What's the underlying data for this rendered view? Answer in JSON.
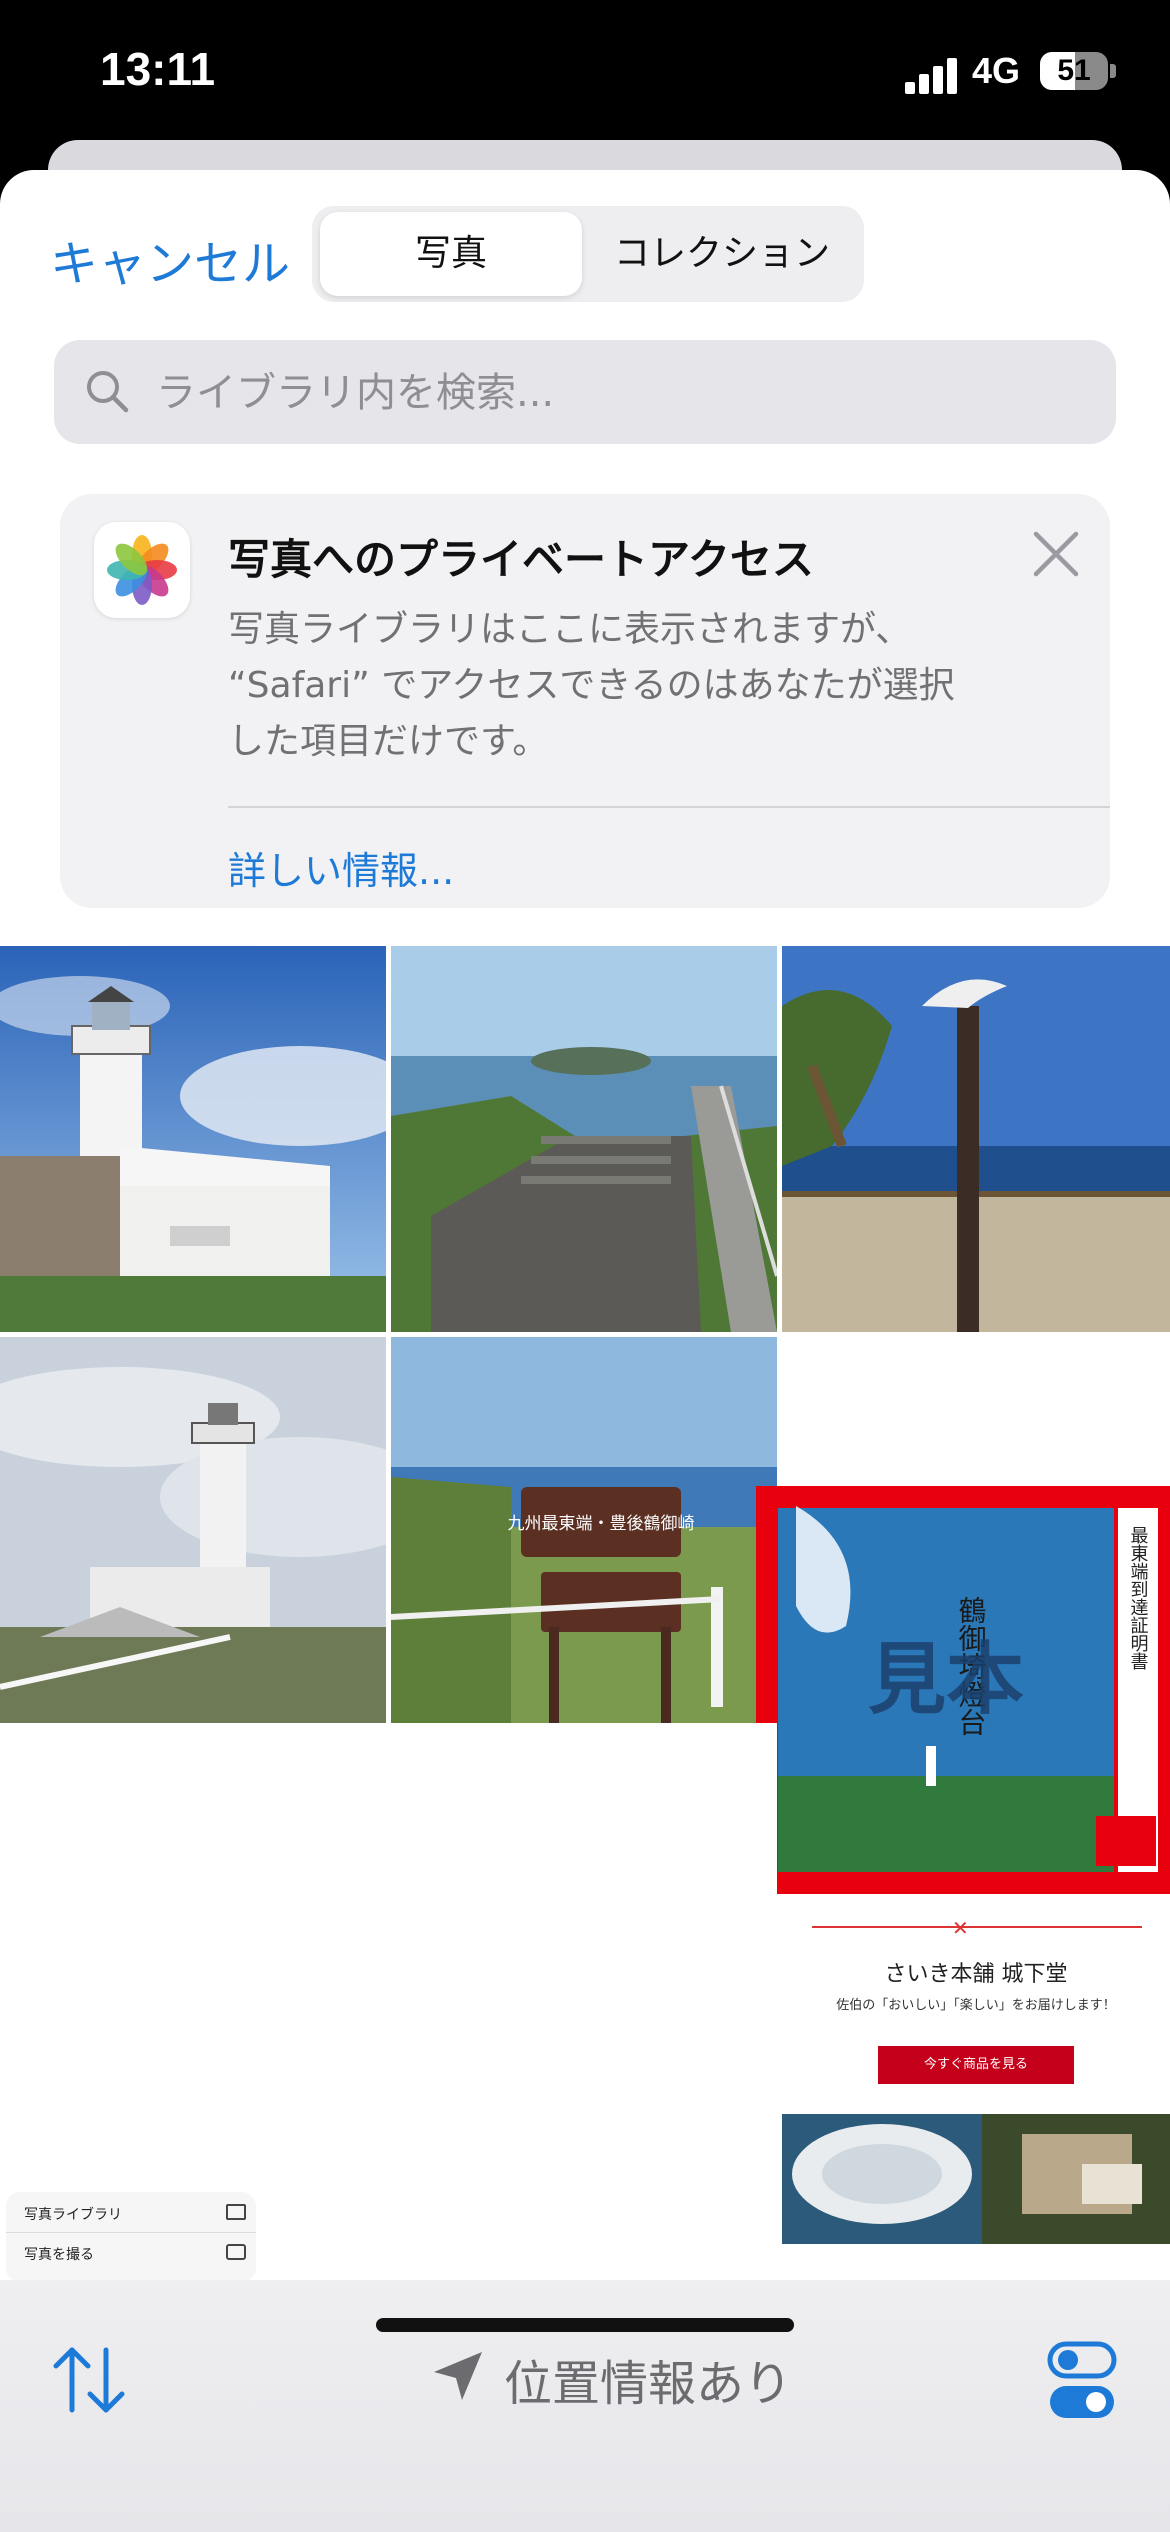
{
  "status_bar": {
    "time": "13:11",
    "network": "4G",
    "battery": "51",
    "battery_level": 0.51
  },
  "nav": {
    "cancel_label": "キャンセル",
    "segments": [
      "写真",
      "コレクション"
    ],
    "selected_segment": "写真"
  },
  "search": {
    "placeholder": "ライブラリ内を検索..."
  },
  "notice": {
    "title": "写真へのプライベートアクセス",
    "body": "写真ライブラリはここに表示されますが、\n“Safari” でアクセスできるのはあなたが選択\nした項目だけです。",
    "link": "詳しい情報..."
  },
  "photos": {
    "ad_store_name": "さいき本舗 城下堂",
    "ad_tagline": "佐伯の「おいしい」「楽しい」をお届けします！",
    "ad_button": "今すぐ商品を見る",
    "sign_text": "九州最東端・豊後鶴御崎",
    "certificate_title": "鶴御埼燈台",
    "certificate_mark": "見本",
    "certificate_side": "最東端到達証明書",
    "menu_items": [
      "写真ライブラリ",
      "写真を撮る"
    ]
  },
  "bottom_bar": {
    "location_label": "位置情報あり"
  },
  "colors": {
    "accent": "#1e7ad7",
    "highlight": "#e8000e"
  }
}
